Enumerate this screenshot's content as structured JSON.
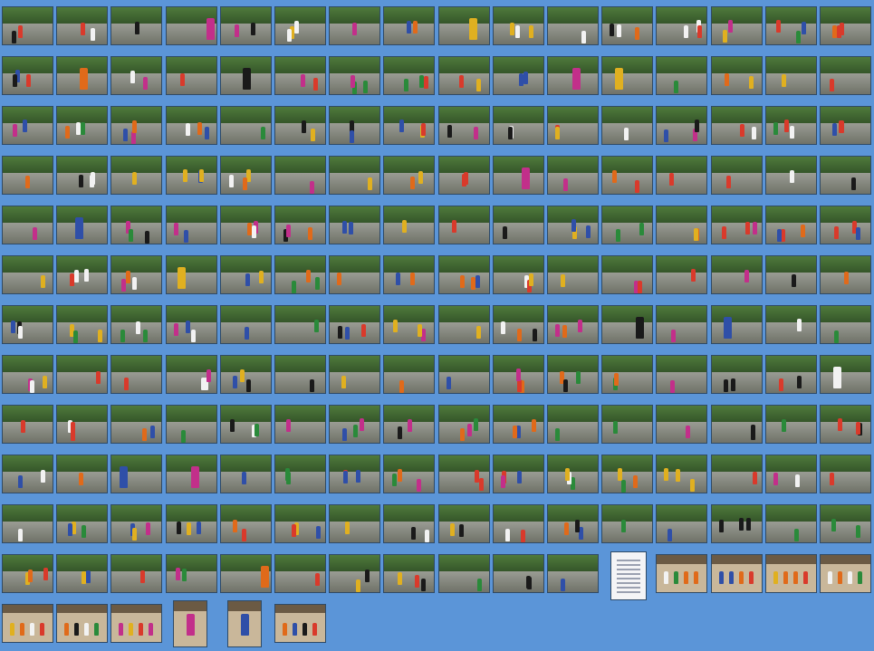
{
  "gallery": {
    "background_color": "#5b95d8",
    "row_count": 13,
    "rows": [
      {
        "count": 16,
        "scene": "start-area"
      },
      {
        "count": 16,
        "scene": "park-path"
      },
      {
        "count": 16,
        "scene": "park-path"
      },
      {
        "count": 16,
        "scene": "park-path"
      },
      {
        "count": 16,
        "scene": "park-path"
      },
      {
        "count": 16,
        "scene": "park-path"
      },
      {
        "count": 16,
        "scene": "park-path"
      },
      {
        "count": 16,
        "scene": "park-path"
      },
      {
        "count": 16,
        "scene": "park-path"
      },
      {
        "count": 16,
        "scene": "park-path"
      },
      {
        "count": 16,
        "scene": "park-path"
      },
      {
        "count": 16,
        "scene": "mixed-finish"
      },
      {
        "count": 6,
        "scene": "awards"
      }
    ],
    "icon_names": {
      "thumbnail": "photo-thumbnail-icon",
      "document": "results-sheet-icon"
    },
    "palette": {
      "foliage": "#4f7a3c",
      "foliage_dark": "#35562a",
      "path": "#9a9c94",
      "path_shadow": "#6f7268",
      "shirt_colors": [
        "#d93a2b",
        "#2f4fa8",
        "#f2f2f2",
        "#e0b020",
        "#1a1a1a",
        "#2a8a3a",
        "#e06a1a",
        "#c22f8a"
      ],
      "awards_wall": "#c9b79a",
      "awards_roof": "#6b5a44",
      "document_paper": "#f4f4f6"
    }
  }
}
